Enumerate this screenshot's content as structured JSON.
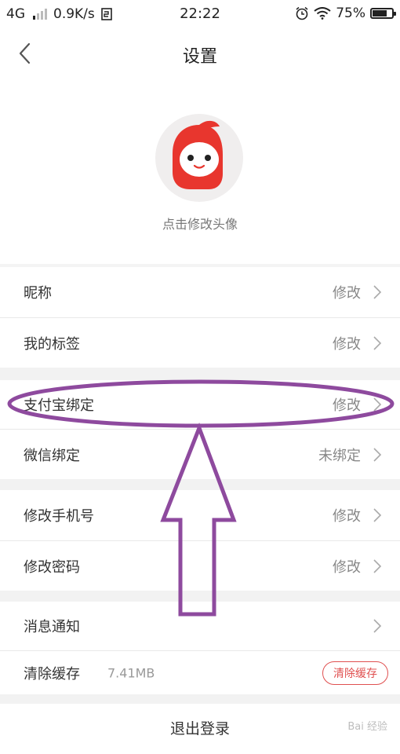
{
  "status_bar": {
    "network": "4G",
    "speed": "0.9K/s",
    "time": "22:22",
    "battery": "75%",
    "battery_level": 0.75,
    "icons": [
      "signal-icon",
      "sim-icon",
      "alarm-icon",
      "wifi-icon",
      "battery-icon"
    ]
  },
  "header": {
    "title": "设置",
    "back_icon": "chevron-left-icon"
  },
  "avatar": {
    "caption": "点击修改头像"
  },
  "rows": {
    "nickname": {
      "label": "昵称",
      "value": "修改"
    },
    "tags": {
      "label": "我的标签",
      "value": "修改"
    },
    "alipay": {
      "label": "支付宝绑定",
      "value": "修改"
    },
    "wechat": {
      "label": "微信绑定",
      "value": "未绑定"
    },
    "phone": {
      "label": "修改手机号",
      "value": "修改"
    },
    "password": {
      "label": "修改密码",
      "value": "修改"
    },
    "notifications": {
      "label": "消息通知"
    },
    "cache": {
      "label": "清除缓存",
      "size": "7.41MB",
      "button": "清除缓存"
    }
  },
  "logout": {
    "label": "退出登录"
  },
  "annotation": {
    "color": "#8e4a9e",
    "shapes": [
      "ellipse",
      "arrow-up"
    ]
  },
  "colors": {
    "accent": "#e05050",
    "avatar_red": "#e8362e"
  }
}
